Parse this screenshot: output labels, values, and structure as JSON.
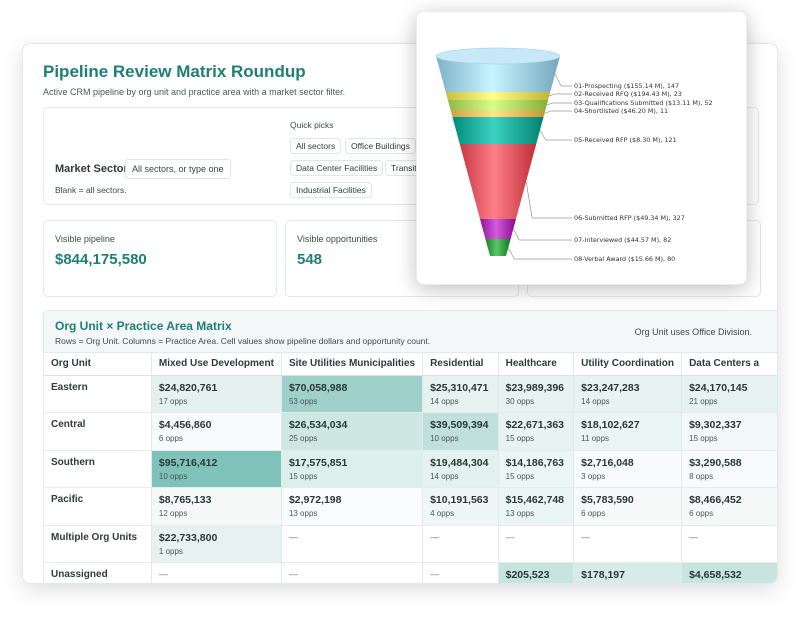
{
  "page": {
    "title": "Pipeline Review Matrix Roundup",
    "subtitle": "Active CRM pipeline by org unit and practice area with a market sector filter."
  },
  "filter": {
    "label": "Market Sector",
    "placeholder": "All sectors, or type one",
    "blank_note": "Blank = all sectors.",
    "quick_picks_label": "Quick picks",
    "chips": [
      "All sectors",
      "Office Buildings",
      "Data Center Facilities",
      "Transit",
      "Industrial Facilities"
    ]
  },
  "stats": [
    {
      "label": "Visible pipeline",
      "value": "$844,175,580"
    },
    {
      "label": "Visible opportunities",
      "value": "548"
    }
  ],
  "matrix": {
    "title": "Org Unit × Practice Area Matrix",
    "subtitle": "Rows = Org Unit. Columns = Practice Area. Cell values show pipeline dollars and opportunity count.",
    "note": "Org Unit uses Office Division.",
    "columns": [
      "Org Unit",
      "Mixed Use Development",
      "Site Utilities Municipalities",
      "Residential",
      "Healthcare",
      "Utility Coordination",
      "Data Centers a"
    ],
    "rows": [
      {
        "name": "Eastern",
        "cells": [
          {
            "value": "$24,820,761",
            "opps": "17 opps"
          },
          {
            "value": "$70,058,988",
            "opps": "53 opps"
          },
          {
            "value": "$25,310,471",
            "opps": "14 opps"
          },
          {
            "value": "$23,989,396",
            "opps": "30 opps"
          },
          {
            "value": "$23,247,283",
            "opps": "14 opps"
          },
          {
            "value": "$24,170,145",
            "opps": "21 opps"
          }
        ]
      },
      {
        "name": "Central",
        "cells": [
          {
            "value": "$4,456,860",
            "opps": "6 opps"
          },
          {
            "value": "$26,534,034",
            "opps": "25 opps"
          },
          {
            "value": "$39,509,394",
            "opps": "10 opps"
          },
          {
            "value": "$22,671,363",
            "opps": "15 opps"
          },
          {
            "value": "$18,102,627",
            "opps": "11 opps"
          },
          {
            "value": "$9,302,337",
            "opps": "15 opps"
          }
        ]
      },
      {
        "name": "Southern",
        "cells": [
          {
            "value": "$95,716,412",
            "opps": "10 opps"
          },
          {
            "value": "$17,575,851",
            "opps": "15 opps"
          },
          {
            "value": "$19,484,304",
            "opps": "14 opps"
          },
          {
            "value": "$14,186,763",
            "opps": "15 opps"
          },
          {
            "value": "$2,716,048",
            "opps": "3 opps"
          },
          {
            "value": "$3,290,588",
            "opps": "8 opps"
          }
        ]
      },
      {
        "name": "Pacific",
        "cells": [
          {
            "value": "$8,765,133",
            "opps": "12 opps"
          },
          {
            "value": "$2,972,198",
            "opps": "13 opps"
          },
          {
            "value": "$10,191,563",
            "opps": "4 opps"
          },
          {
            "value": "$15,462,748",
            "opps": "13 opps"
          },
          {
            "value": "$5,783,590",
            "opps": "6 opps"
          },
          {
            "value": "$8,466,452",
            "opps": "6 opps"
          }
        ]
      },
      {
        "name": "Multiple Org Units",
        "cells": [
          {
            "value": "$22,733,800",
            "opps": "1 opps"
          },
          {
            "value": "—",
            "opps": ""
          },
          {
            "value": "—",
            "opps": ""
          },
          {
            "value": "—",
            "opps": ""
          },
          {
            "value": "—",
            "opps": ""
          },
          {
            "value": "—",
            "opps": ""
          }
        ]
      },
      {
        "name": "Unassigned",
        "cells": [
          {
            "value": "—",
            "opps": ""
          },
          {
            "value": "—",
            "opps": ""
          },
          {
            "value": "—",
            "opps": ""
          },
          {
            "value": "$205,523",
            "opps": ""
          },
          {
            "value": "$178,197",
            "opps": ""
          },
          {
            "value": "$4,658,532",
            "opps": ""
          }
        ]
      }
    ]
  },
  "funnel": {
    "stages": [
      {
        "label": "01-Prospecting ($155.14 M), 147",
        "color": "#a8d8f0"
      },
      {
        "label": "02-Received RFQ ($194.43 M), 23",
        "color": "#f2e56a"
      },
      {
        "label": "03-Qualifications Submitted ($13.11 M), 52",
        "color": "#b8e06a"
      },
      {
        "label": "04-Shortlisted ($46.20 M), 11",
        "color": "#f6c86a"
      },
      {
        "label": "05-Received RFP ($8.30 M), 121",
        "color": "#1fb3a3"
      },
      {
        "label": "06-Submitted RFP ($49.34 M), 327",
        "color": "#f0606a"
      },
      {
        "label": "07-Interviewed ($44.57 M), 82",
        "color": "#b83cc0"
      },
      {
        "label": "08-Verbal Award ($15.66 M), 80",
        "color": "#3fa84a"
      }
    ]
  }
}
